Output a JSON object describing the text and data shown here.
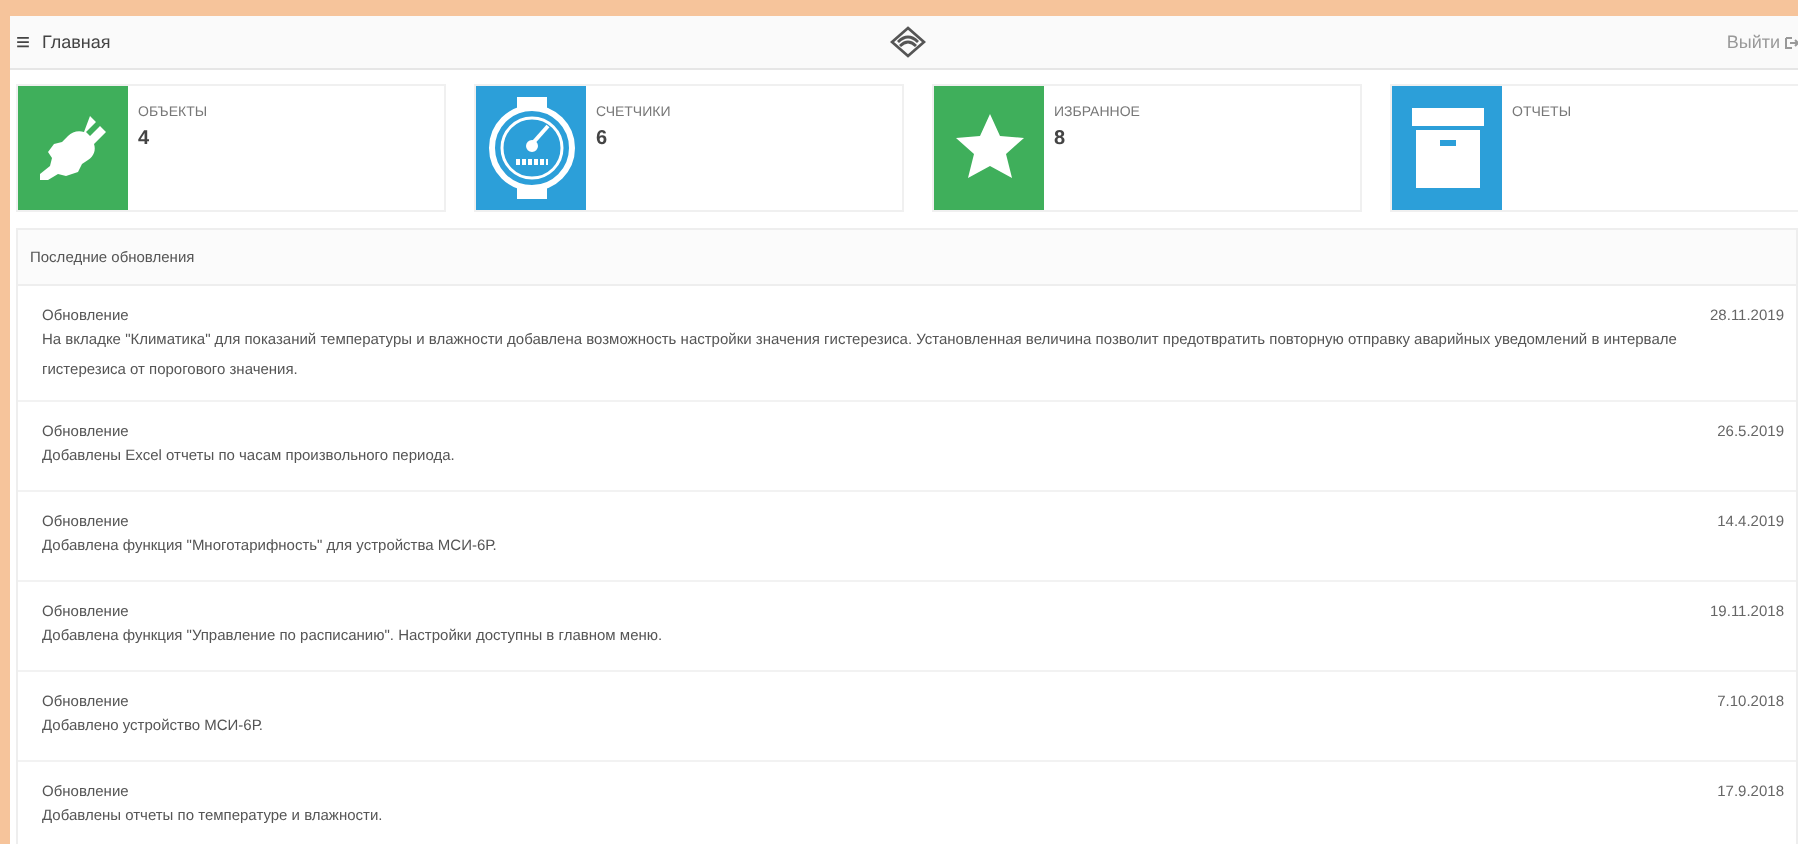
{
  "header": {
    "menu_icon": "≡",
    "title": "Главная",
    "logout": "Выйти"
  },
  "cards": [
    {
      "label": "ОБЪЕКТЫ",
      "count": "4",
      "color": "#3faf5b"
    },
    {
      "label": "СЧЕТЧИКИ",
      "count": "6",
      "color": "#2c9fd9"
    },
    {
      "label": "ИЗБРАННОЕ",
      "count": "8",
      "color": "#3faf5b"
    },
    {
      "label": "ОТЧЕТЫ",
      "color": "#2c9fd9"
    }
  ],
  "updates": {
    "title": "Последние обновления",
    "items": [
      {
        "title": "Обновление",
        "text": "На вкладке \"Климатика\" для показаний температуры и влажности добавлена возможность настройки значения гистерезиса. Установленная величина позволит предотвратить повторную отправку аварийных уведомлений в интервале гистерезиса от порогового значения.",
        "date": "28.11.2019"
      },
      {
        "title": "Обновление",
        "text": "Добавлены Excel отчеты по часам произвольного периода.",
        "date": "26.5.2019"
      },
      {
        "title": "Обновление",
        "text": "Добавлена функция \"Многотарифность\" для устройства МСИ-6Р.",
        "date": "14.4.2019"
      },
      {
        "title": "Обновление",
        "text": "Добавлена функция \"Управление по расписанию\". Настройки доступны в главном меню.",
        "date": "19.11.2018"
      },
      {
        "title": "Обновление",
        "text": "Добавлено устройство МСИ-6Р.",
        "date": "7.10.2018"
      },
      {
        "title": "Обновление",
        "text": "Добавлены отчеты по температуре и влажности.",
        "date": "17.9.2018"
      }
    ]
  }
}
